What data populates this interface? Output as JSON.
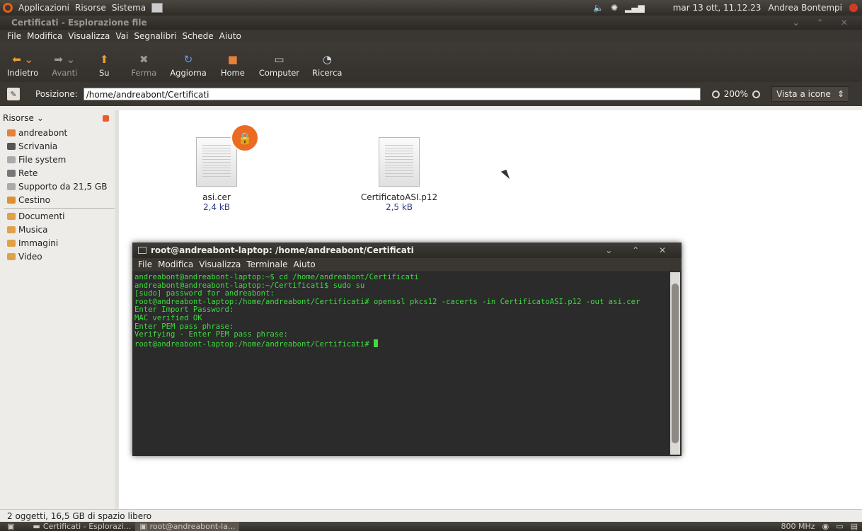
{
  "top_panel": {
    "menus": [
      "Applicazioni",
      "Risorse",
      "Sistema"
    ],
    "clock": "mar 13 ott, 11.12.23",
    "user": "Andrea Bontempi"
  },
  "file_manager": {
    "title": "Certificati - Esplorazione file",
    "menu": [
      "File",
      "Modifica",
      "Visualizza",
      "Vai",
      "Segnalibri",
      "Schede",
      "Aiuto"
    ],
    "toolbar": {
      "back": "Indietro",
      "forward": "Avanti",
      "up": "Su",
      "stop": "Ferma",
      "reload": "Aggiorna",
      "home": "Home",
      "computer": "Computer",
      "search": "Ricerca"
    },
    "location": {
      "label": "Posizione:",
      "path": "/home/andreabont/Certificati",
      "zoom": "200%",
      "view": "Vista a icone"
    },
    "sidebar": {
      "header": "Risorse",
      "places": [
        "andreabont",
        "Scrivania",
        "File system",
        "Rete",
        "Supporto da 21,5 GB",
        "Cestino"
      ],
      "bookmarks": [
        "Documenti",
        "Musica",
        "Immagini",
        "Video"
      ]
    },
    "files": [
      {
        "name": "asi.cer",
        "size": "2,4 kB",
        "locked": true
      },
      {
        "name": "CertificatoASI.p12",
        "size": "2,5 kB",
        "locked": false
      }
    ],
    "status": "2 oggetti, 16,5 GB di spazio libero"
  },
  "terminal": {
    "title": "root@andreabont-laptop: /home/andreabont/Certificati",
    "menu": [
      "File",
      "Modifica",
      "Visualizza",
      "Terminale",
      "Aiuto"
    ],
    "lines": [
      "andreabont@andreabont-laptop:~$ cd /home/andreabont/Certificati",
      "andreabont@andreabont-laptop:~/Certificati$ sudo su",
      "[sudo] password for andreabont:",
      "root@andreabont-laptop:/home/andreabont/Certificati# openssl pkcs12 -cacerts -in CertificatoASI.p12 -out asi.cer",
      "Enter Import Password:",
      "MAC verified OK",
      "Enter PEM pass phrase:",
      "Verifying - Enter PEM pass phrase:"
    ],
    "prompt": "root@andreabont-laptop:/home/andreabont/Certificati# "
  },
  "bottom_panel": {
    "tasks": [
      "Certificati - Esplorazi...",
      "root@andreabont-la..."
    ],
    "cpu": "800 MHz"
  }
}
